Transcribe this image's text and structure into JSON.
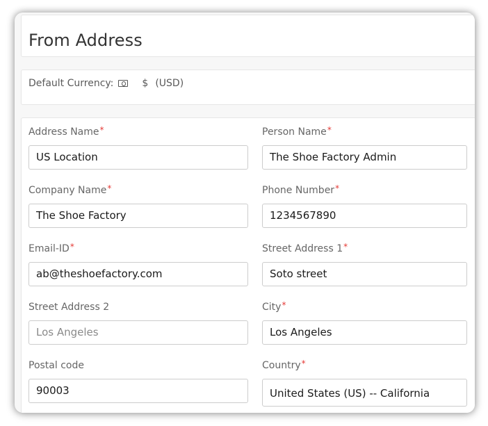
{
  "header": {
    "title": "From Address"
  },
  "currency": {
    "label": "Default Currency:",
    "icon": "money-icon",
    "symbol": "$",
    "code": "(USD)"
  },
  "form": {
    "required_marker": "*",
    "fields": {
      "address_name": {
        "label": "Address Name",
        "required": true,
        "value": "US Location"
      },
      "person_name": {
        "label": "Person Name",
        "required": true,
        "value": "The Shoe Factory Admin"
      },
      "company_name": {
        "label": "Company Name",
        "required": true,
        "value": "The Shoe Factory"
      },
      "phone_number": {
        "label": "Phone Number",
        "required": true,
        "value": "1234567890"
      },
      "email_id": {
        "label": "Email-ID",
        "required": true,
        "value": "ab@theshoefactory.com"
      },
      "street_address_1": {
        "label": "Street Address 1",
        "required": true,
        "value": "Soto street"
      },
      "street_address_2": {
        "label": "Street Address 2",
        "required": false,
        "value": "",
        "placeholder": "Los Angeles"
      },
      "city": {
        "label": "City",
        "required": true,
        "value": "Los Angeles"
      },
      "postal_code": {
        "label": "Postal code",
        "required": false,
        "value": "90003"
      },
      "country": {
        "label": "Country",
        "required": true,
        "value": "United States (US) -- California"
      }
    }
  },
  "colors": {
    "required": "#e53935",
    "label": "#666666",
    "title": "#333333",
    "input_border": "#cccccc"
  }
}
